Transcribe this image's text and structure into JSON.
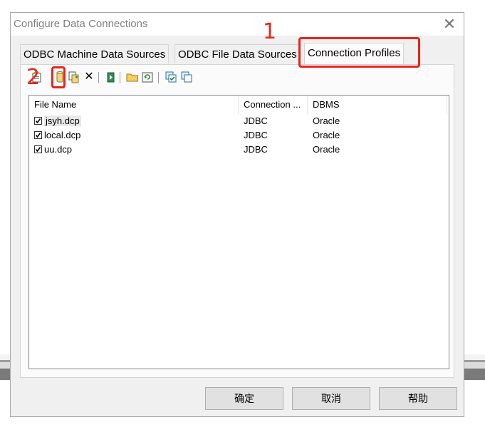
{
  "dialog": {
    "title": "Configure Data Connections",
    "close_glyph": "✕"
  },
  "tabs": [
    {
      "label": "ODBC Machine Data Sources",
      "active": false
    },
    {
      "label": "ODBC File Data Sources",
      "active": false
    },
    {
      "label": "Connection Profiles",
      "active": true
    }
  ],
  "toolbar": {
    "buttons": [
      {
        "icon": "new-profile-icon"
      },
      {
        "icon": "new-connection-icon"
      },
      {
        "icon": "copy-profile-icon"
      },
      {
        "icon": "delete-icon",
        "glyph": "✕"
      },
      {
        "icon": "test-connection-icon"
      },
      {
        "icon": "open-folder-icon"
      },
      {
        "icon": "refresh-folder-icon"
      },
      {
        "icon": "check-all-icon"
      },
      {
        "icon": "uncheck-all-icon"
      }
    ]
  },
  "list": {
    "columns": [
      "File Name",
      "Connection ...",
      "DBMS"
    ],
    "rows": [
      {
        "checked": true,
        "file": "jsyh.dcp",
        "connection": "JDBC",
        "dbms": "Oracle"
      },
      {
        "checked": true,
        "file": "local.dcp",
        "connection": "JDBC",
        "dbms": "Oracle"
      },
      {
        "checked": true,
        "file": "uu.dcp",
        "connection": "JDBC",
        "dbms": "Oracle"
      }
    ]
  },
  "buttons": {
    "ok": "确定",
    "cancel": "取消",
    "help": "帮助"
  },
  "annotations": {
    "one": "1",
    "two": "2",
    "color": "#e8231a"
  }
}
